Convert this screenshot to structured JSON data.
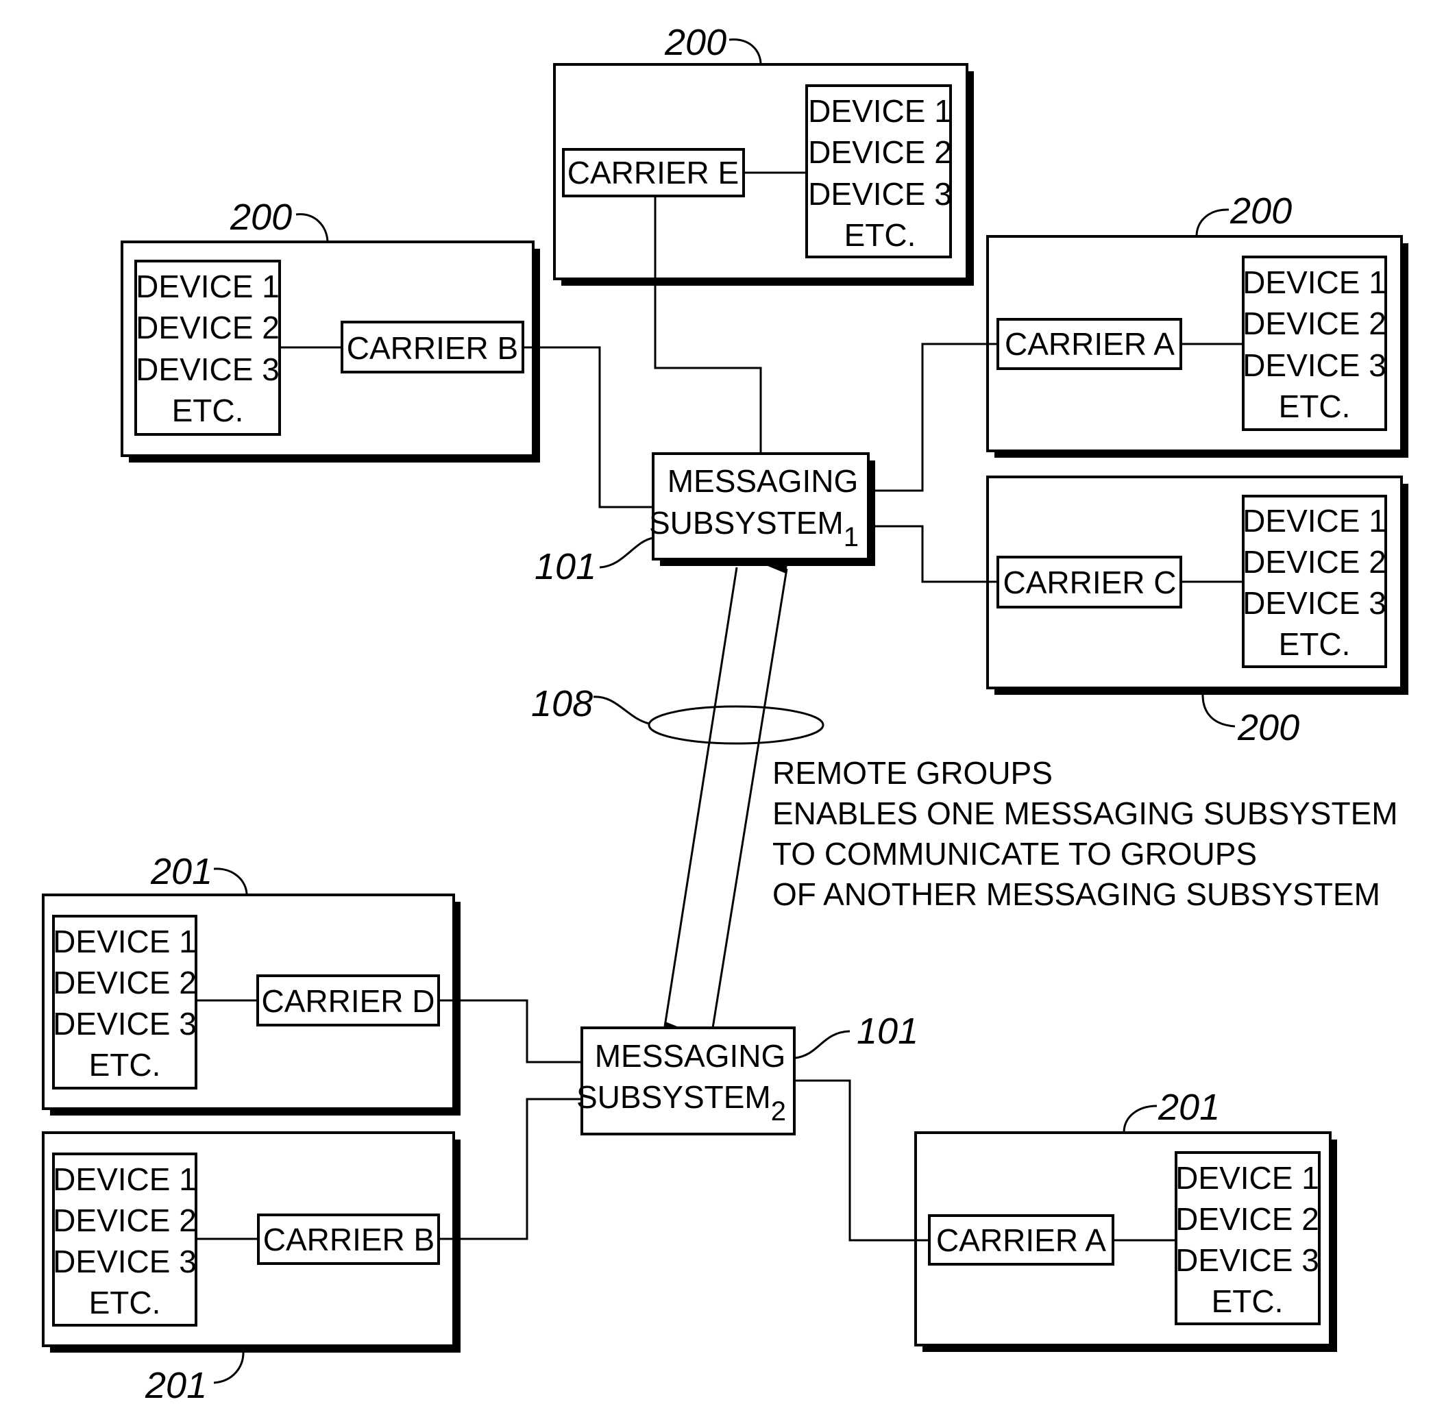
{
  "figure": {
    "messaging_subsystems": [
      {
        "line1": "MESSAGING",
        "line2": "SUBSYSTEM",
        "subscript": "1",
        "ref": "101"
      },
      {
        "line1": "MESSAGING",
        "line2": "SUBSYSTEM",
        "subscript": "2",
        "ref": "101"
      }
    ],
    "groups": [
      {
        "ref": "200",
        "carrier": "CARRIER E",
        "devices": [
          "DEVICE 1",
          "DEVICE 2",
          "DEVICE 3",
          "ETC."
        ]
      },
      {
        "ref": "200",
        "carrier": "CARRIER B",
        "devices": [
          "DEVICE 1",
          "DEVICE 2",
          "DEVICE 3",
          "ETC."
        ]
      },
      {
        "ref": "200",
        "carrier": "CARRIER A",
        "devices": [
          "DEVICE 1",
          "DEVICE 2",
          "DEVICE 3",
          "ETC."
        ]
      },
      {
        "ref": "200",
        "carrier": "CARRIER C",
        "devices": [
          "DEVICE 1",
          "DEVICE 2",
          "DEVICE 3",
          "ETC."
        ]
      },
      {
        "ref": "201",
        "carrier": "CARRIER D",
        "devices": [
          "DEVICE 1",
          "DEVICE 2",
          "DEVICE 3",
          "ETC."
        ]
      },
      {
        "ref": "201",
        "carrier": "CARRIER B",
        "devices": [
          "DEVICE 1",
          "DEVICE 2",
          "DEVICE 3",
          "ETC."
        ]
      },
      {
        "ref": "201",
        "carrier": "CARRIER A",
        "devices": [
          "DEVICE 1",
          "DEVICE 2",
          "DEVICE 3",
          "ETC."
        ]
      }
    ],
    "link_ref": "108",
    "note_lines": [
      "REMOTE GROUPS",
      "ENABLES ONE MESSAGING SUBSYSTEM",
      "TO COMMUNICATE TO GROUPS",
      "OF ANOTHER MESSAGING SUBSYSTEM"
    ]
  }
}
